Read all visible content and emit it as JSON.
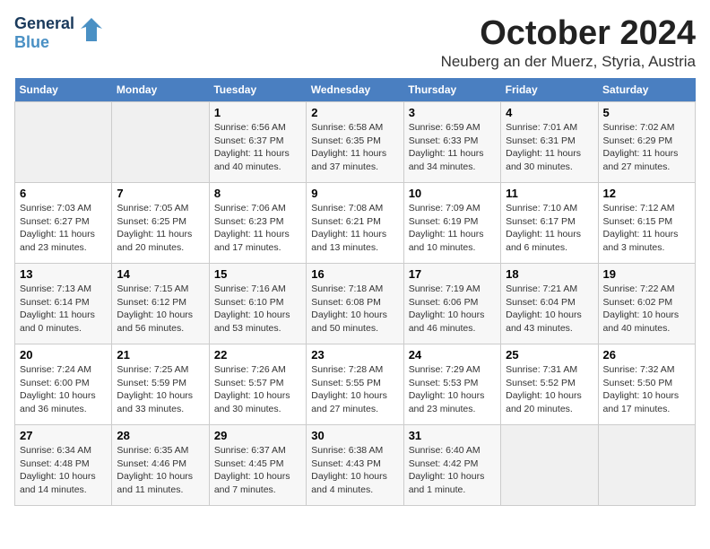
{
  "header": {
    "logo_line1": "General",
    "logo_line2": "Blue",
    "title": "October 2024",
    "subtitle": "Neuberg an der Muerz, Styria, Austria"
  },
  "days_of_week": [
    "Sunday",
    "Monday",
    "Tuesday",
    "Wednesday",
    "Thursday",
    "Friday",
    "Saturday"
  ],
  "weeks": [
    [
      {
        "day": "",
        "info": ""
      },
      {
        "day": "",
        "info": ""
      },
      {
        "day": "1",
        "info": "Sunrise: 6:56 AM\nSunset: 6:37 PM\nDaylight: 11 hours and 40 minutes."
      },
      {
        "day": "2",
        "info": "Sunrise: 6:58 AM\nSunset: 6:35 PM\nDaylight: 11 hours and 37 minutes."
      },
      {
        "day": "3",
        "info": "Sunrise: 6:59 AM\nSunset: 6:33 PM\nDaylight: 11 hours and 34 minutes."
      },
      {
        "day": "4",
        "info": "Sunrise: 7:01 AM\nSunset: 6:31 PM\nDaylight: 11 hours and 30 minutes."
      },
      {
        "day": "5",
        "info": "Sunrise: 7:02 AM\nSunset: 6:29 PM\nDaylight: 11 hours and 27 minutes."
      }
    ],
    [
      {
        "day": "6",
        "info": "Sunrise: 7:03 AM\nSunset: 6:27 PM\nDaylight: 11 hours and 23 minutes."
      },
      {
        "day": "7",
        "info": "Sunrise: 7:05 AM\nSunset: 6:25 PM\nDaylight: 11 hours and 20 minutes."
      },
      {
        "day": "8",
        "info": "Sunrise: 7:06 AM\nSunset: 6:23 PM\nDaylight: 11 hours and 17 minutes."
      },
      {
        "day": "9",
        "info": "Sunrise: 7:08 AM\nSunset: 6:21 PM\nDaylight: 11 hours and 13 minutes."
      },
      {
        "day": "10",
        "info": "Sunrise: 7:09 AM\nSunset: 6:19 PM\nDaylight: 11 hours and 10 minutes."
      },
      {
        "day": "11",
        "info": "Sunrise: 7:10 AM\nSunset: 6:17 PM\nDaylight: 11 hours and 6 minutes."
      },
      {
        "day": "12",
        "info": "Sunrise: 7:12 AM\nSunset: 6:15 PM\nDaylight: 11 hours and 3 minutes."
      }
    ],
    [
      {
        "day": "13",
        "info": "Sunrise: 7:13 AM\nSunset: 6:14 PM\nDaylight: 11 hours and 0 minutes."
      },
      {
        "day": "14",
        "info": "Sunrise: 7:15 AM\nSunset: 6:12 PM\nDaylight: 10 hours and 56 minutes."
      },
      {
        "day": "15",
        "info": "Sunrise: 7:16 AM\nSunset: 6:10 PM\nDaylight: 10 hours and 53 minutes."
      },
      {
        "day": "16",
        "info": "Sunrise: 7:18 AM\nSunset: 6:08 PM\nDaylight: 10 hours and 50 minutes."
      },
      {
        "day": "17",
        "info": "Sunrise: 7:19 AM\nSunset: 6:06 PM\nDaylight: 10 hours and 46 minutes."
      },
      {
        "day": "18",
        "info": "Sunrise: 7:21 AM\nSunset: 6:04 PM\nDaylight: 10 hours and 43 minutes."
      },
      {
        "day": "19",
        "info": "Sunrise: 7:22 AM\nSunset: 6:02 PM\nDaylight: 10 hours and 40 minutes."
      }
    ],
    [
      {
        "day": "20",
        "info": "Sunrise: 7:24 AM\nSunset: 6:00 PM\nDaylight: 10 hours and 36 minutes."
      },
      {
        "day": "21",
        "info": "Sunrise: 7:25 AM\nSunset: 5:59 PM\nDaylight: 10 hours and 33 minutes."
      },
      {
        "day": "22",
        "info": "Sunrise: 7:26 AM\nSunset: 5:57 PM\nDaylight: 10 hours and 30 minutes."
      },
      {
        "day": "23",
        "info": "Sunrise: 7:28 AM\nSunset: 5:55 PM\nDaylight: 10 hours and 27 minutes."
      },
      {
        "day": "24",
        "info": "Sunrise: 7:29 AM\nSunset: 5:53 PM\nDaylight: 10 hours and 23 minutes."
      },
      {
        "day": "25",
        "info": "Sunrise: 7:31 AM\nSunset: 5:52 PM\nDaylight: 10 hours and 20 minutes."
      },
      {
        "day": "26",
        "info": "Sunrise: 7:32 AM\nSunset: 5:50 PM\nDaylight: 10 hours and 17 minutes."
      }
    ],
    [
      {
        "day": "27",
        "info": "Sunrise: 6:34 AM\nSunset: 4:48 PM\nDaylight: 10 hours and 14 minutes."
      },
      {
        "day": "28",
        "info": "Sunrise: 6:35 AM\nSunset: 4:46 PM\nDaylight: 10 hours and 11 minutes."
      },
      {
        "day": "29",
        "info": "Sunrise: 6:37 AM\nSunset: 4:45 PM\nDaylight: 10 hours and 7 minutes."
      },
      {
        "day": "30",
        "info": "Sunrise: 6:38 AM\nSunset: 4:43 PM\nDaylight: 10 hours and 4 minutes."
      },
      {
        "day": "31",
        "info": "Sunrise: 6:40 AM\nSunset: 4:42 PM\nDaylight: 10 hours and 1 minute."
      },
      {
        "day": "",
        "info": ""
      },
      {
        "day": "",
        "info": ""
      }
    ]
  ]
}
